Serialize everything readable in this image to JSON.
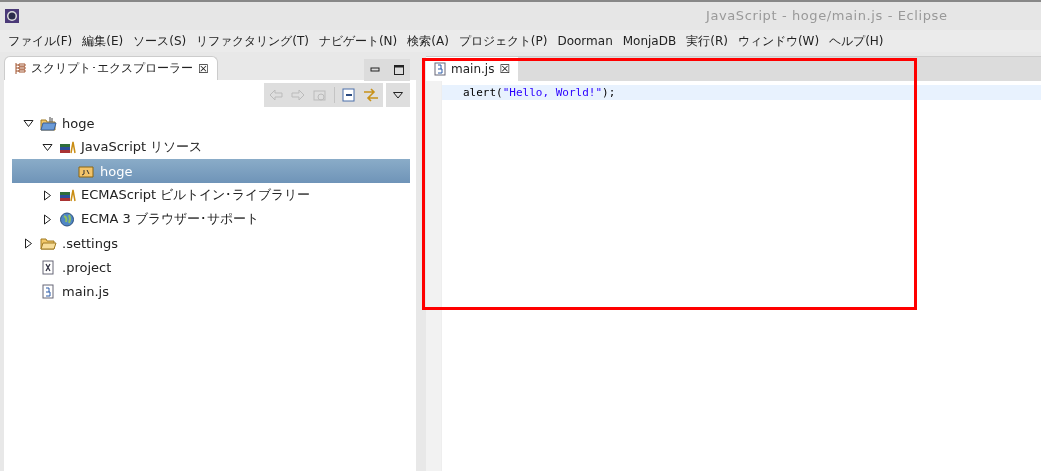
{
  "window": {
    "title": "JavaScript - hoge/main.js - Eclipse"
  },
  "menu": [
    "ファイル(F)",
    "編集(E)",
    "ソース(S)",
    "リファクタリング(T)",
    "ナビゲート(N)",
    "検索(A)",
    "プロジェクト(P)",
    "Doorman",
    "MonjaDB",
    "実行(R)",
    "ウィンドウ(W)",
    "ヘルプ(H)"
  ],
  "explorer": {
    "title": "スクリプト･エクスプローラー",
    "close": "☒",
    "tree": [
      {
        "label": "hoge",
        "kind": "project",
        "expanded": true,
        "selected": false,
        "children": [
          {
            "label": "JavaScript リソース",
            "kind": "library",
            "expanded": true,
            "selected": false,
            "children": [
              {
                "label": "hoge",
                "kind": "package",
                "selected": true
              }
            ]
          },
          {
            "label": "ECMAScript ビルトイン･ライブラリー",
            "kind": "library",
            "expanded": false,
            "selected": false
          },
          {
            "label": "ECMA 3 ブラウザー･サポート",
            "kind": "globe",
            "expanded": false,
            "selected": false
          }
        ]
      },
      {
        "label": ".settings",
        "kind": "folder",
        "expanded": false,
        "selected": false
      },
      {
        "label": ".project",
        "kind": "xml",
        "selected": false
      },
      {
        "label": "main.js",
        "kind": "js",
        "selected": false
      }
    ]
  },
  "editor": {
    "tab": {
      "label": "main.js",
      "close": "☒",
      "selected": true
    },
    "lines": [
      [
        {
          "text": "alert(",
          "kind": "plain"
        },
        {
          "text": "\"Hello, World!\"",
          "kind": "string"
        },
        {
          "text": ");",
          "kind": "plain"
        }
      ]
    ]
  },
  "annotation": {
    "kind": "highlight"
  }
}
